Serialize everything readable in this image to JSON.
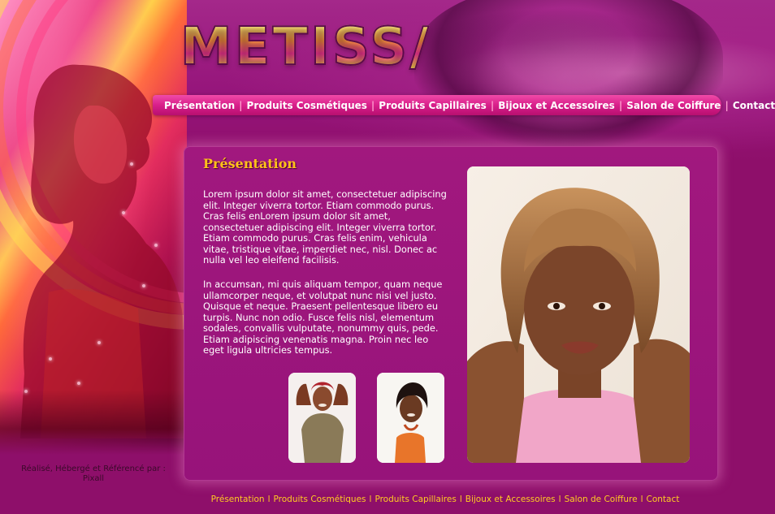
{
  "brand": {
    "logo_text": "METISS/"
  },
  "nav": {
    "items": [
      {
        "label": "Présentation"
      },
      {
        "label": "Produits Cosmétiques"
      },
      {
        "label": "Produits Capillaires"
      },
      {
        "label": "Bijoux et Accessoires"
      },
      {
        "label": "Salon de Coiffure"
      },
      {
        "label": "Contact"
      }
    ],
    "separator": "|"
  },
  "main": {
    "heading": "Présentation",
    "paragraphs": [
      "Lorem ipsum dolor sit amet, consectetuer adipiscing elit. Integer viverra tortor. Etiam commodo purus. Cras felis enLorem ipsum dolor sit amet, consectetuer adipiscing elit. Integer viverra tortor. Etiam commodo purus. Cras felis enim, vehicula vitae, tristique vitae, imperdiet nec, nisl. Donec ac nulla vel leo eleifend facilisis.",
      " In accumsan, mi quis aliquam tempor, quam neque ullamcorper neque, et volutpat nunc nisi vel justo. Quisque et neque. Praesent pellentesque libero eu turpis. Nunc non odio. Fusce felis nisl, elementum sodales, convallis vulputate, nonummy quis, pede. Etiam adipiscing venenatis magna. Proin nec leo eget ligula ultricies tempus."
    ]
  },
  "credits": {
    "line1": "Réalisé, Hébergé et Référencé par :",
    "line2": "Pixall"
  },
  "footer": {
    "items": [
      {
        "label": "Présentation"
      },
      {
        "label": "Produits Cosmétiques"
      },
      {
        "label": "Produits Capillaires"
      },
      {
        "label": "Bijoux et Accessoires"
      },
      {
        "label": "Salon de Coiffure"
      },
      {
        "label": "Contact"
      }
    ],
    "separator": "l"
  },
  "colors": {
    "background": "#8e0f6a",
    "nav_bar": "#d81f8a",
    "heading": "#ffc21a",
    "footer_links": "#ffcc22"
  }
}
